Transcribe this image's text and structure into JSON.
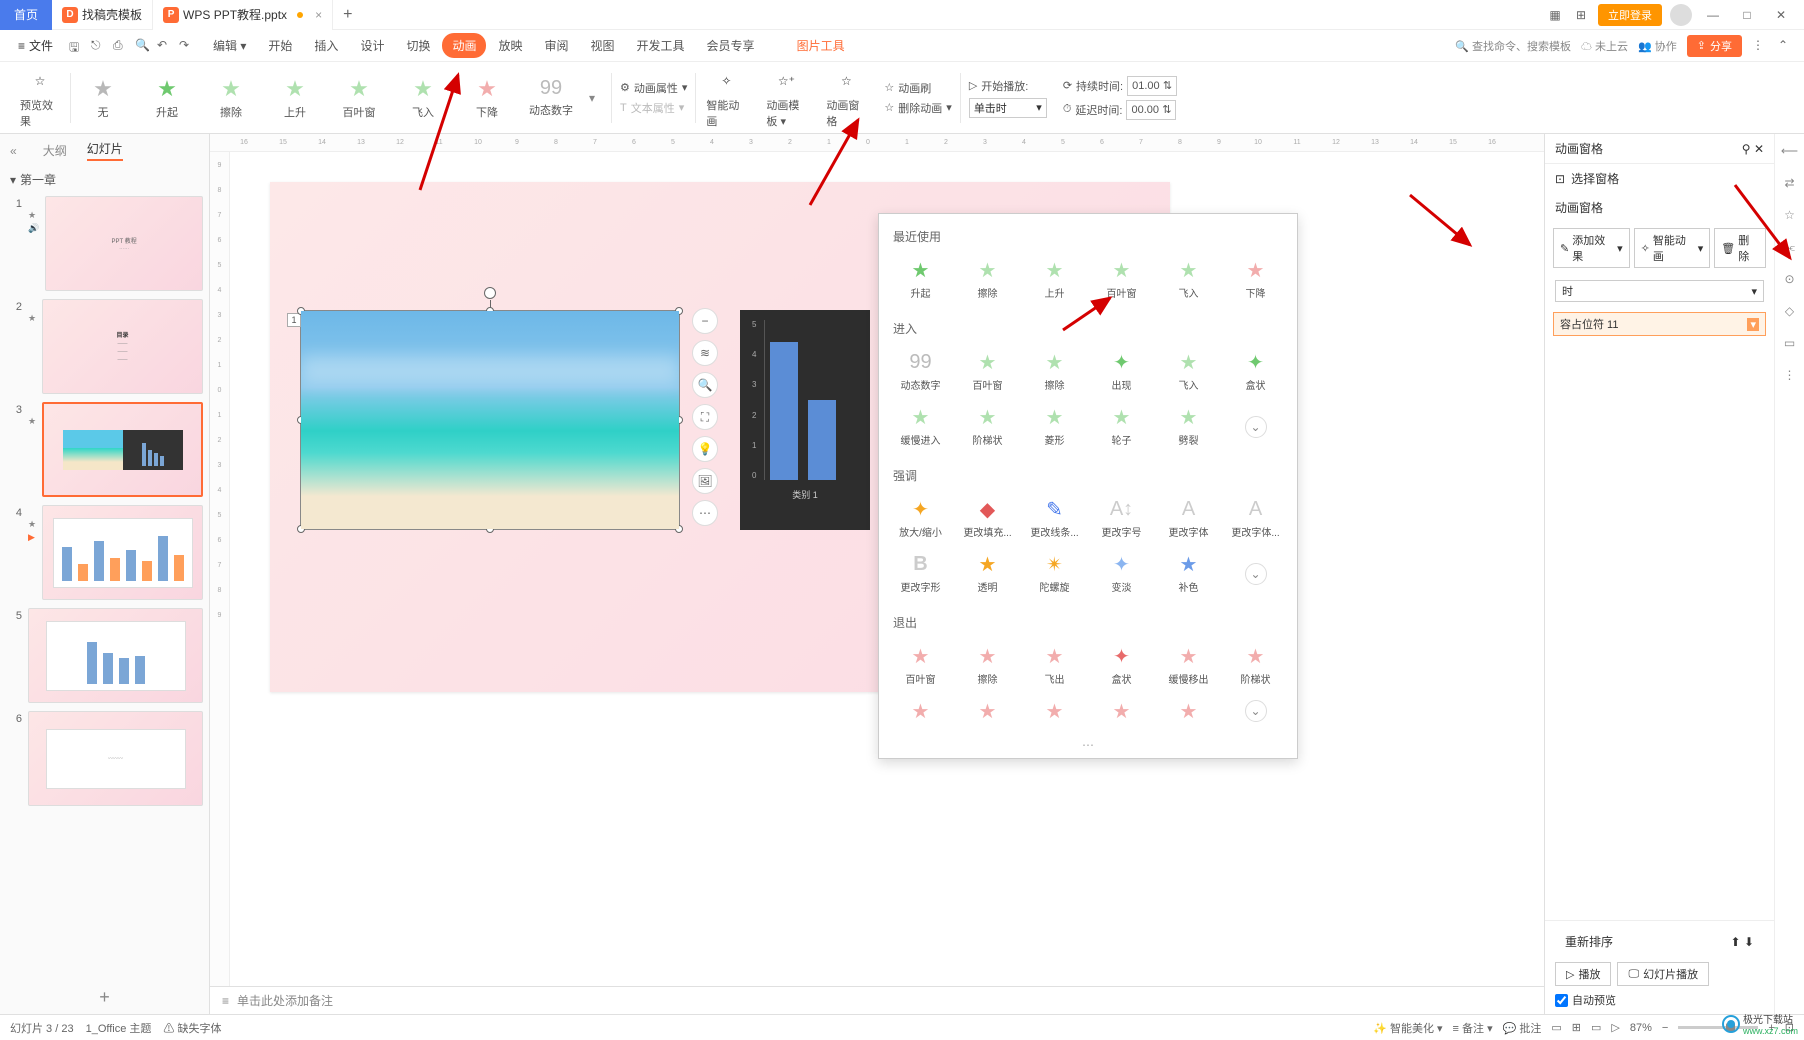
{
  "titlebar": {
    "home": "首页",
    "tab1": "找稿壳模板",
    "tab2": "WPS PPT教程.pptx",
    "login": "立即登录"
  },
  "menu": {
    "file": "文件",
    "edit": "编辑",
    "items": [
      "开始",
      "插入",
      "设计",
      "切换",
      "动画",
      "放映",
      "审阅",
      "视图",
      "开发工具",
      "会员专享"
    ],
    "context": "图片工具",
    "search_placeholder": "查找命令、搜索模板",
    "cloud": "未上云",
    "coop": "协作",
    "share": "分享"
  },
  "ribbon": {
    "preview_effect": "预览效果",
    "gallery": [
      "无",
      "升起",
      "擦除",
      "上升",
      "百叶窗",
      "飞入",
      "下降",
      "动态数字"
    ],
    "anim_prop": "动画属性",
    "text_prop": "文本属性",
    "smart_anim": "智能动画",
    "anim_template": "动画模板",
    "anim_pane": "动画窗格",
    "anim_brush": "动画刷",
    "delete_anim": "删除动画",
    "start_play": "开始播放:",
    "trigger": "单击时",
    "duration": "持续时间:",
    "duration_val": "01.00",
    "delay": "延迟时间:",
    "delay_val": "00.00"
  },
  "sidebar": {
    "tab_outline": "大纲",
    "tab_slides": "幻灯片",
    "chapter": "第一章",
    "nums": [
      "1",
      "2",
      "3",
      "4",
      "5",
      "6"
    ]
  },
  "slide": {
    "anim_badge": "1",
    "chart_ticks": [
      "5",
      "4",
      "3",
      "2",
      "1",
      "0"
    ],
    "chart_label": "类别 1"
  },
  "popup": {
    "sec_recent": "最近使用",
    "recent": [
      "升起",
      "擦除",
      "上升",
      "百叶窗",
      "飞入",
      "下降"
    ],
    "sec_enter": "进入",
    "enter1": [
      "动态数字",
      "百叶窗",
      "擦除",
      "出现",
      "飞入",
      "盒状"
    ],
    "enter2": [
      "缓慢进入",
      "阶梯状",
      "菱形",
      "轮子",
      "劈裂"
    ],
    "sec_emph": "强调",
    "emph1": [
      "放大/缩小",
      "更改填充...",
      "更改线条...",
      "更改字号",
      "更改字体",
      "更改字体..."
    ],
    "emph2": [
      "更改字形",
      "透明",
      "陀螺旋",
      "变淡",
      "补色"
    ],
    "sec_exit": "退出",
    "exit1": [
      "百叶窗",
      "擦除",
      "飞出",
      "盒状",
      "缓慢移出",
      "阶梯状"
    ]
  },
  "rpanel": {
    "title": "动画窗格",
    "select_pane": "选择窗格",
    "section": "动画窗格",
    "add_effect": "添加效果",
    "smart": "智能动画",
    "delete": "删除",
    "trigger_label": "时",
    "entry": "容占位符 11",
    "reorder": "重新排序",
    "play": "播放",
    "slideshow": "幻灯片播放",
    "auto_preview": "自动预览"
  },
  "notes": "单击此处添加备注",
  "status": {
    "slide_pos": "幻灯片 3 / 23",
    "theme": "1_Office 主题",
    "missing_font": "缺失字体",
    "beauty": "智能美化",
    "notes": "备注",
    "comments": "批注",
    "zoom": "87%"
  },
  "watermark": {
    "t1": "极光下载站",
    "t2": "www.xz7.com"
  }
}
